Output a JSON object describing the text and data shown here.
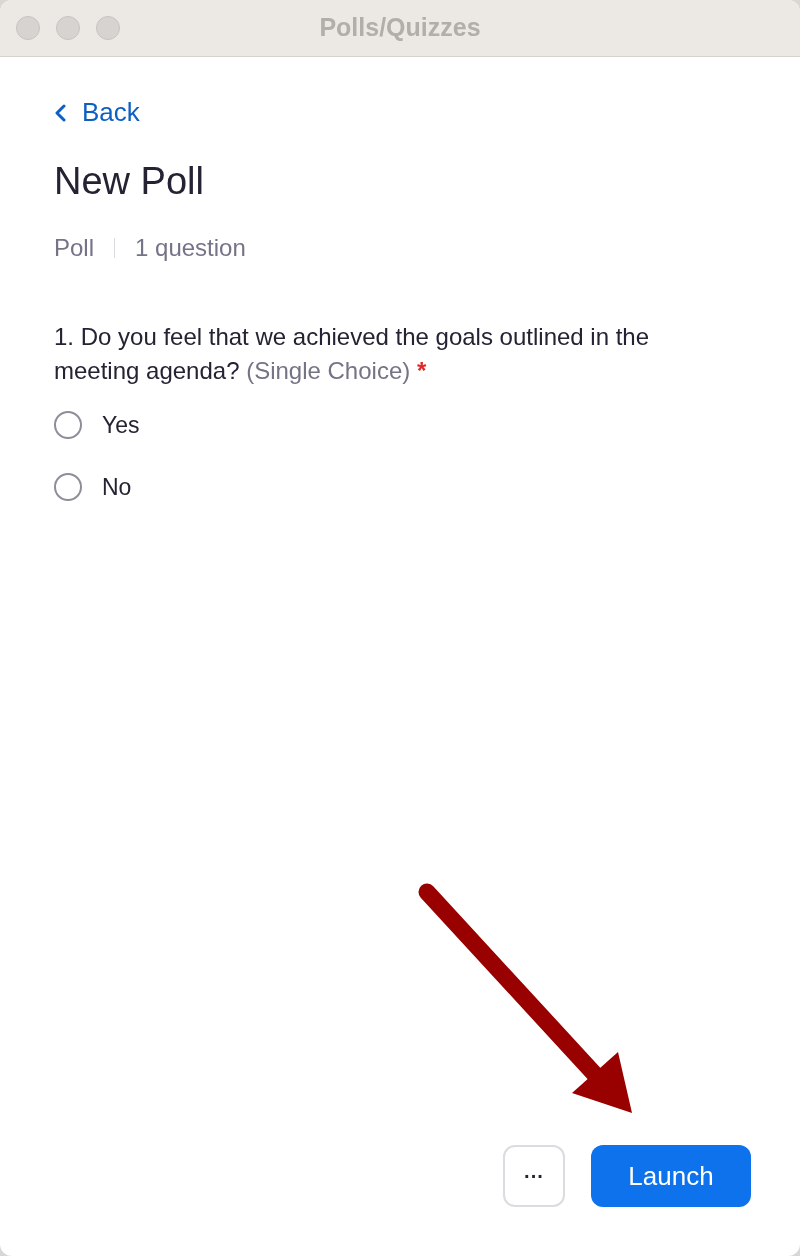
{
  "window": {
    "title": "Polls/Quizzes"
  },
  "back": {
    "label": "Back"
  },
  "title": "New Poll",
  "meta": {
    "type": "Poll",
    "count": "1 question"
  },
  "question": {
    "text": "1. Do you feel that we achieved the goals outlined in the meeting agenda?",
    "hint": "(Single Choice)",
    "required_mark": "*",
    "options": [
      {
        "label": "Yes",
        "selected": false
      },
      {
        "label": "No",
        "selected": false
      }
    ]
  },
  "buttons": {
    "more": "···",
    "launch": "Launch"
  }
}
